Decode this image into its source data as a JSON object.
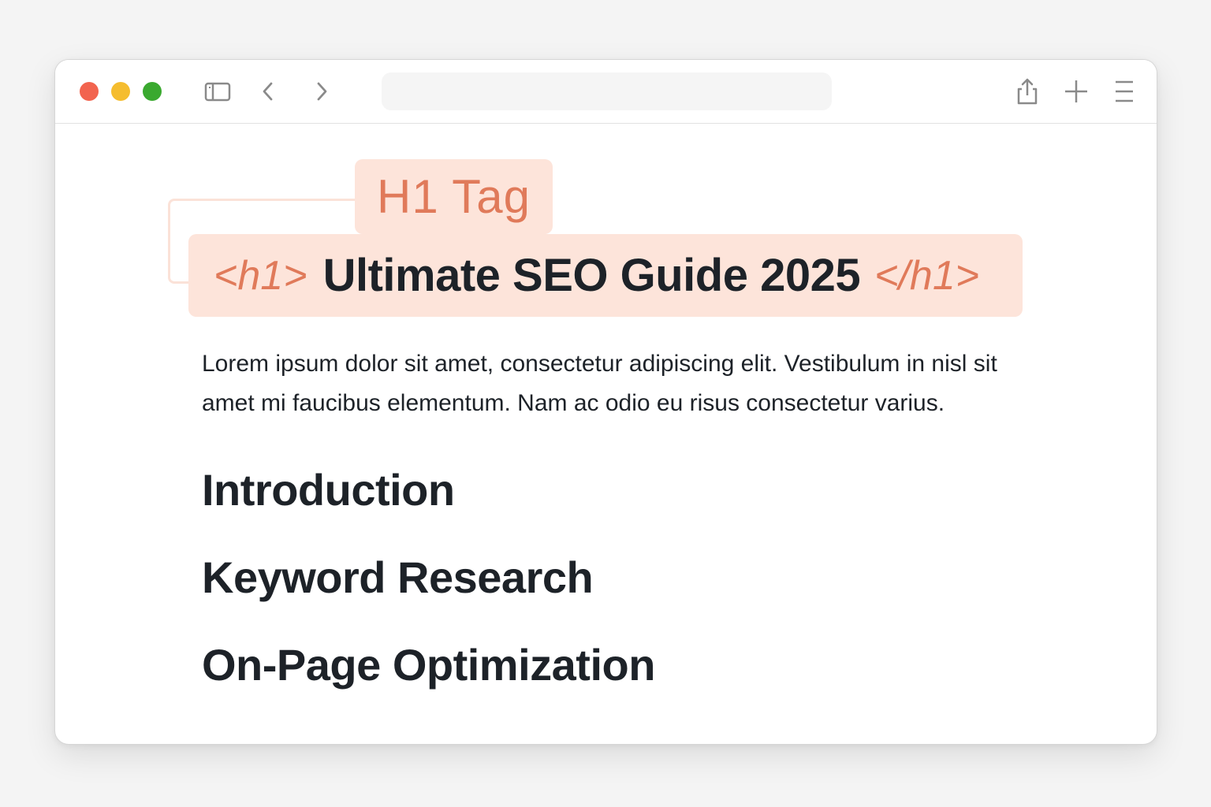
{
  "browser": {
    "icons": {
      "sidebar": "sidebar-icon",
      "back": "chevron-left-icon",
      "forward": "chevron-right-icon",
      "share": "share-icon",
      "new_tab": "plus-icon",
      "menu": "menu-icon"
    },
    "address_bar": {
      "value": ""
    }
  },
  "annotation": {
    "label": "H1 Tag",
    "open_tag": "<h1>",
    "close_tag": "</h1>",
    "accent_color": "#e07a5a",
    "highlight_color": "#fde4da"
  },
  "page": {
    "h1": "Ultimate SEO Guide 2025",
    "paragraph": "Lorem ipsum dolor sit amet, consectetur adipiscing elit. Vestibulum in nisl sit amet mi faucibus elementum. Nam ac odio eu risus consectetur varius.",
    "headings": [
      "Introduction",
      "Keyword Research",
      "On-Page Optimization"
    ]
  }
}
